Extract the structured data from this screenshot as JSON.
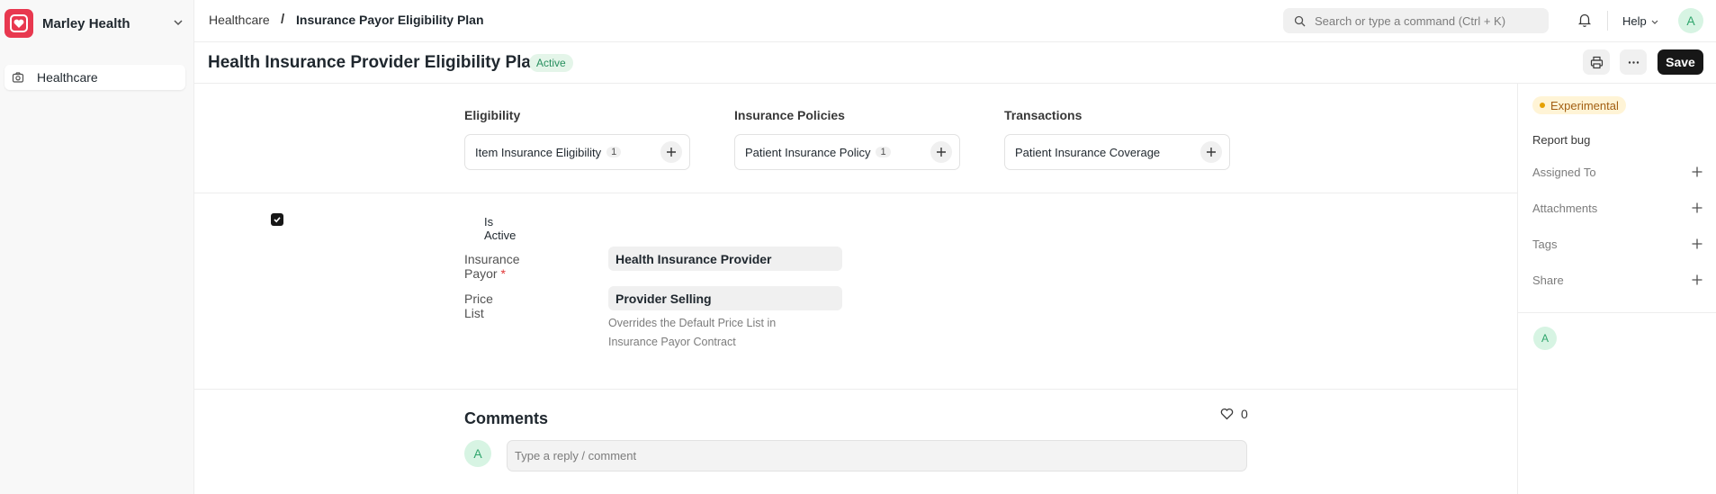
{
  "colors": {
    "brand": "#e8384f",
    "accent": "#171717",
    "success": "#30a66d",
    "warning": "#e5a000"
  },
  "sidebar": {
    "brand_name": "Marley Health",
    "items": [
      {
        "label": "Healthcare",
        "icon": "camera-icon"
      }
    ]
  },
  "topbar": {
    "breadcrumbs": [
      "Healthcare",
      "Insurance Payor Eligibility Plan"
    ],
    "breadcrumb_separator": "/",
    "search_placeholder": "Search or type a command (Ctrl + K)",
    "help_label": "Help",
    "avatar_initial": "A"
  },
  "titlebar": {
    "title": "Health Insurance Provider Eligibility Plan",
    "status": "Active",
    "save_label": "Save"
  },
  "connections": [
    {
      "heading": "Eligibility",
      "link": "Item Insurance Eligibility",
      "count": "1"
    },
    {
      "heading": "Insurance Policies",
      "link": "Patient Insurance Policy",
      "count": "1"
    },
    {
      "heading": "Transactions",
      "link": "Patient Insurance Coverage",
      "count": ""
    }
  ],
  "form": {
    "is_active_label": "Is Active",
    "is_active": true,
    "insurance_payor_label": "Insurance Payor",
    "required_mark": "*",
    "insurance_payor_value": "Health Insurance Provider",
    "price_list_label": "Price List",
    "price_list_value": "Provider Selling",
    "price_list_help": "Overrides the Default Price List in Insurance Payor Contract"
  },
  "comments": {
    "title": "Comments",
    "likes": "0",
    "avatar_initial": "A",
    "placeholder": "Type a reply / comment"
  },
  "rightbar": {
    "badge": "Experimental",
    "report_bug": "Report bug",
    "rows": [
      "Assigned To",
      "Attachments",
      "Tags",
      "Share"
    ],
    "avatar_initial": "A"
  }
}
